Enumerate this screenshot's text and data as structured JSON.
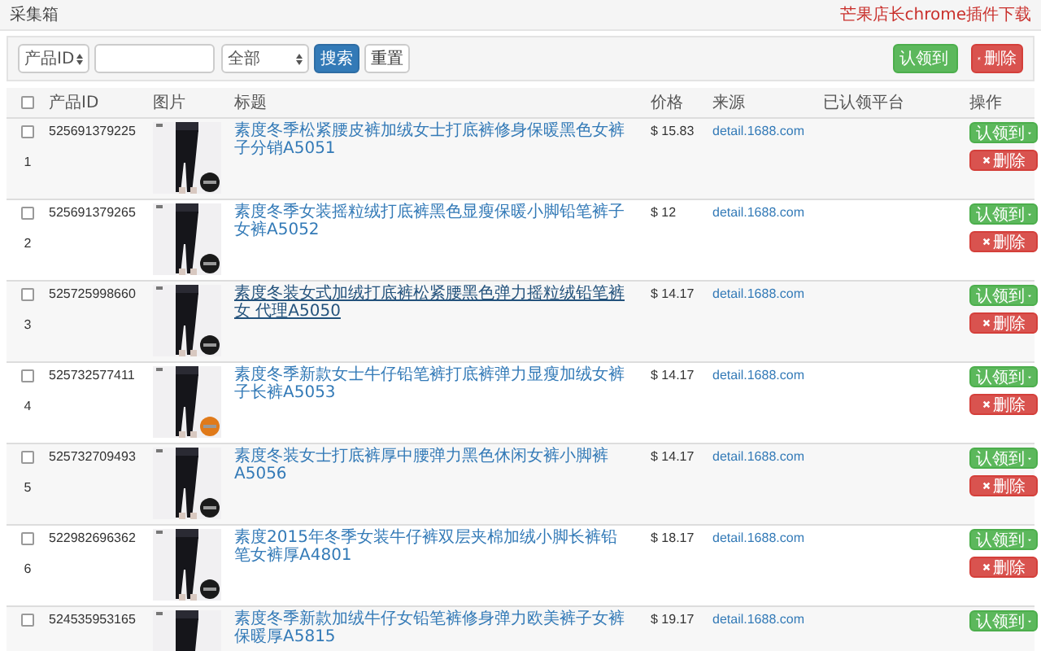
{
  "header": {
    "title": "采集箱",
    "link": "芒果店长chrome插件下载"
  },
  "toolbar": {
    "field_select": "产品ID",
    "filter_select": "全部",
    "search_button": "搜索",
    "reset_button": "重置",
    "claim_button": "认领到",
    "delete_button": "删除"
  },
  "table": {
    "select_all": {
      "checked": false
    },
    "columns": [
      "产品ID",
      "图片",
      "标题",
      "价格",
      "来源",
      "已认领平台",
      "操作"
    ],
    "rows": [
      {
        "index": "1",
        "checked": false,
        "id": "525691379225",
        "title": "素度冬季松紧腰皮裤加绒女士打底裤修身保暖黑色女裤子分销A5051",
        "hovered": false,
        "price": "$ 15.83",
        "source": "detail.1688.com",
        "claim": "认领到",
        "delete": "删除"
      },
      {
        "index": "2",
        "checked": false,
        "id": "525691379265",
        "title": "素度冬季女装摇粒绒打底裤黑色显瘦保暖小脚铅笔裤子女裤A5052",
        "hovered": false,
        "price": "$ 12",
        "source": "detail.1688.com",
        "claim": "认领到",
        "delete": "删除"
      },
      {
        "index": "3",
        "checked": false,
        "id": "525725998660",
        "title": "素度冬装女式加绒打底裤松紧腰黑色弹力摇粒绒铅笔裤女 代理A5050",
        "hovered": true,
        "price": "$ 14.17",
        "source": "detail.1688.com",
        "claim": "认领到",
        "delete": "删除"
      },
      {
        "index": "4",
        "checked": false,
        "id": "525732577411",
        "title": "素度冬季新款女士牛仔铅笔裤打底裤弹力显瘦加绒女裤子长裤A5053",
        "hovered": false,
        "price": "$ 14.17",
        "source": "detail.1688.com",
        "claim": "认领到",
        "delete": "删除"
      },
      {
        "index": "5",
        "checked": false,
        "id": "525732709493",
        "title": "素度冬装女士打底裤厚中腰弹力黑色休闲女裤小脚裤A5056",
        "hovered": false,
        "price": "$ 14.17",
        "source": "detail.1688.com",
        "claim": "认领到",
        "delete": "删除"
      },
      {
        "index": "6",
        "checked": false,
        "id": "522982696362",
        "title": "素度2015年冬季女装牛仔裤双层夹棉加绒小脚长裤铅笔女裤厚A4801",
        "hovered": false,
        "price": "$ 18.17",
        "source": "detail.1688.com",
        "claim": "认领到",
        "delete": "删除"
      },
      {
        "checked": false,
        "id": "524535953165",
        "title": "素度冬季新款加绒牛仔女铅笔裤修身弹力欧美裤子女裤保暖厚A5815",
        "hovered": false,
        "price": "$ 19.17",
        "source": "detail.1688.com",
        "claim": "认领到"
      }
    ]
  }
}
